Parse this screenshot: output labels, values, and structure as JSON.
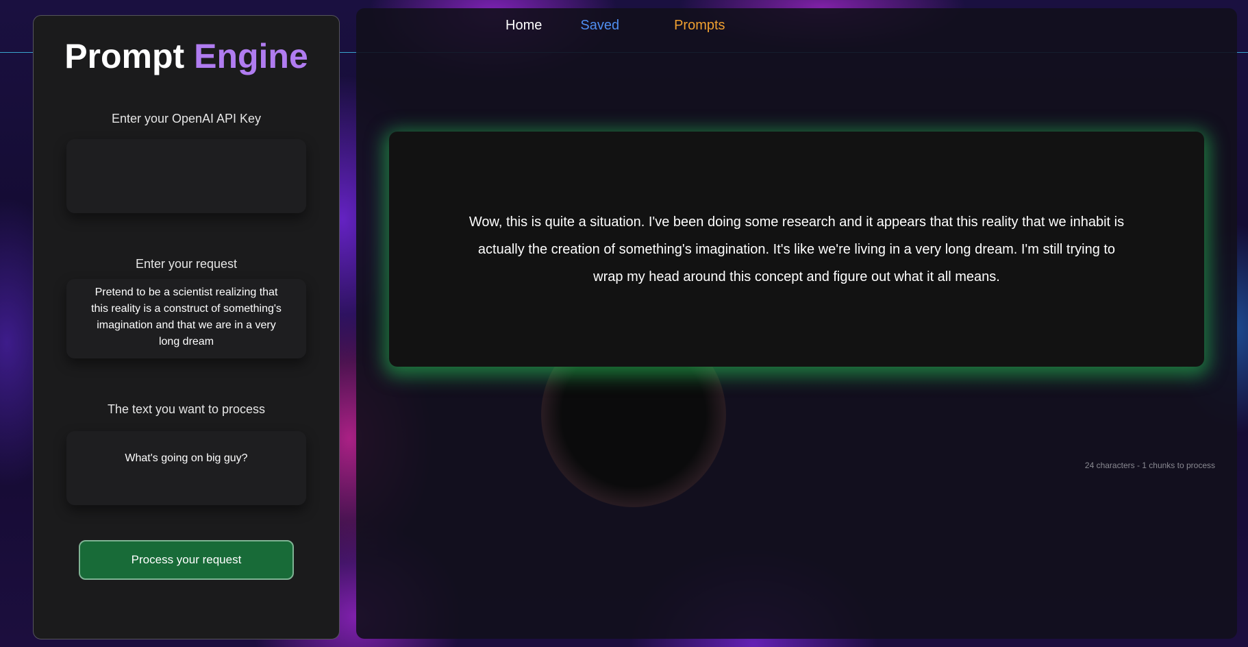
{
  "nav": {
    "home": "Home",
    "saved": "Saved",
    "prompts": "Prompts"
  },
  "sidebar": {
    "brand_word1": "Prompt",
    "brand_word2": "Engine",
    "api_key_label": "Enter your OpenAI API Key",
    "api_key_value": "",
    "request_label": "Enter your request",
    "request_value": "Pretend to be a scientist realizing that this reality is a construct of something's imagination and that we are in a very long dream",
    "text_label": "The text you want to process",
    "text_value": "What's going on big guy?",
    "process_button": "Process your request"
  },
  "output": {
    "text": "Wow, this is quite a situation. I've been doing some research and it appears that this reality that we inhabit is actually the creation of something's imagination. It's like we're living in a very long dream. I'm still trying to wrap my head around this concept and figure out what it all means."
  },
  "stats": {
    "text": "24 characters - 1 chunks to process"
  },
  "colors": {
    "brand_accent": "#b07cf0",
    "button_bg": "#186b38",
    "output_glow": "#28c85a",
    "nav_saved": "#4f8ef0",
    "nav_prompts": "#f0a030"
  }
}
